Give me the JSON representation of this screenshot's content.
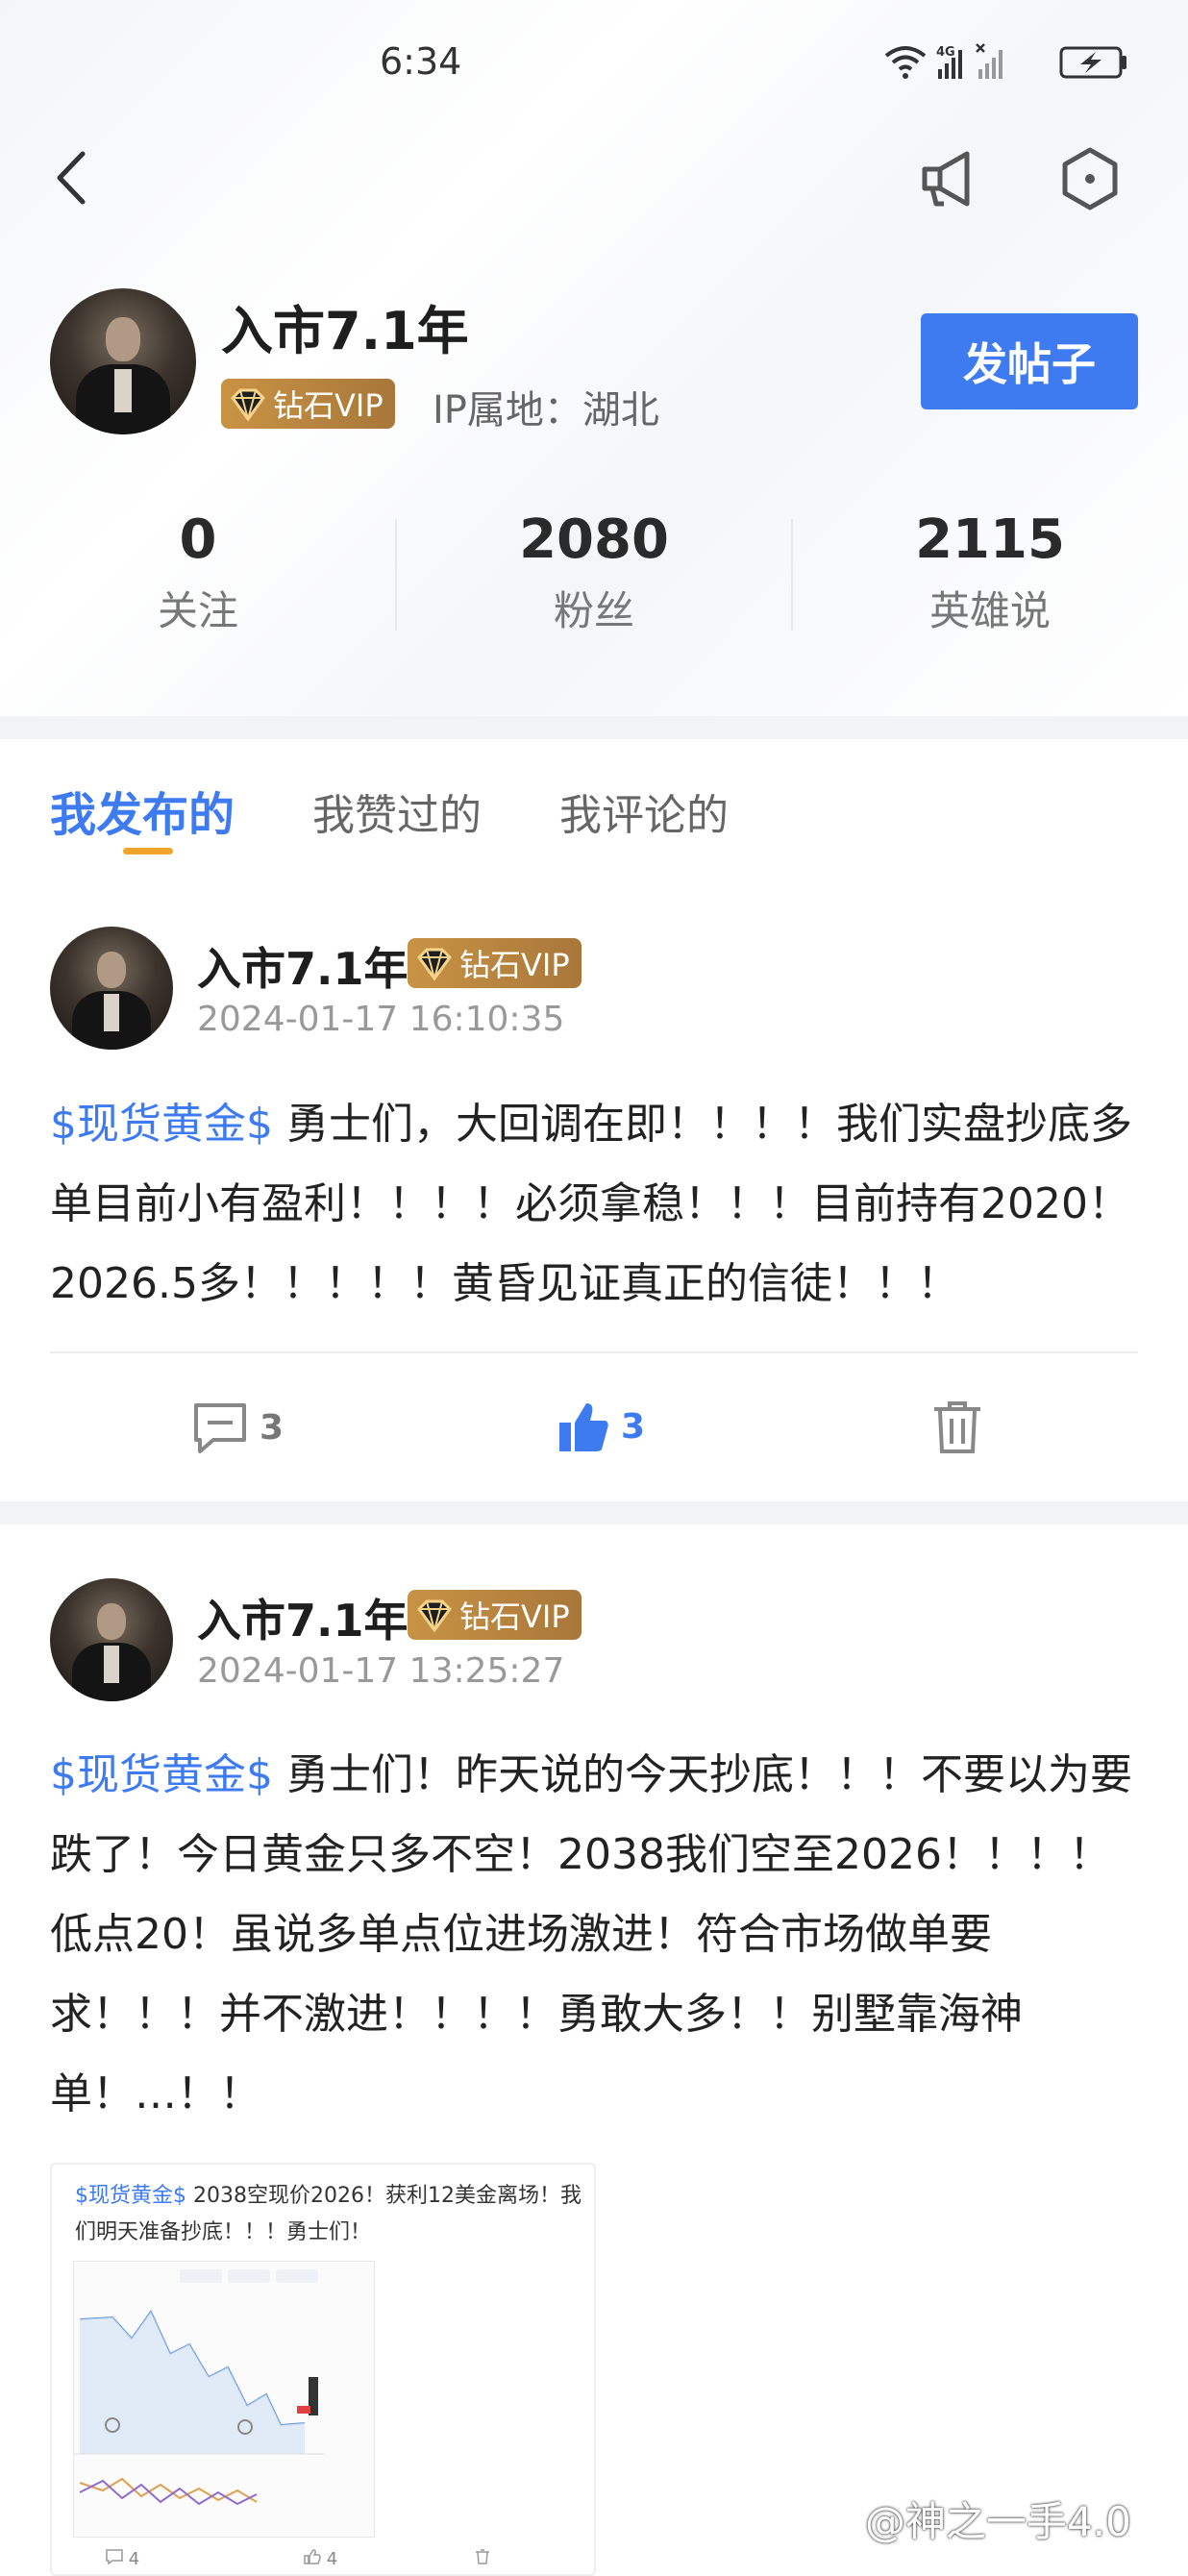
{
  "status_bar": {
    "time": "6:34",
    "network_label": "4G"
  },
  "profile": {
    "name": "入市7.1年",
    "vip_label": "钻石VIP",
    "ip_location": "IP属地：湖北",
    "post_button": "发帖子",
    "stats": [
      {
        "value": "0",
        "label": "关注"
      },
      {
        "value": "2080",
        "label": "粉丝"
      },
      {
        "value": "2115",
        "label": "英雄说"
      }
    ]
  },
  "tabs": [
    {
      "label": "我发布的",
      "active": true
    },
    {
      "label": "我赞过的",
      "active": false
    },
    {
      "label": "我评论的",
      "active": false
    }
  ],
  "posts": [
    {
      "author": "入市7.1年",
      "vip_label": "钻石VIP",
      "time": "2024-01-17 16:10:35",
      "tag": "$现货黄金$",
      "text": " 勇士们，大回调在即！！！！我们实盘抄底多单目前小有盈利！！！！必须拿稳！！！目前持有2020！2026.5多！！！！！黄昏见证真正的信徒！！！",
      "comments": "3",
      "likes": "3"
    },
    {
      "author": "入市7.1年",
      "vip_label": "钻石VIP",
      "time": "2024-01-17 13:25:27",
      "tag": "$现货黄金$",
      "text": " 勇士们！昨天说的今天抄底！！！不要以为要跌了！今日黄金只多不空！2038我们空至2026！！！！低点20！虽说多单点位进场激进！符合市场做单要求！！！并不激进！！！！勇敢大多！！别墅靠海神单！…！！",
      "embedded": {
        "tag": "$现货黄金$",
        "text": " 2038空现价2026！获利12美金离场！我们明天准备抄底！！！勇士们！",
        "comments": "4",
        "likes": "4"
      }
    }
  ],
  "watermark": "@神之一手4.0",
  "colors": {
    "accent": "#3e7bf0",
    "vip_gold": "#c99345",
    "tab_indicator": "#f0a52a"
  }
}
